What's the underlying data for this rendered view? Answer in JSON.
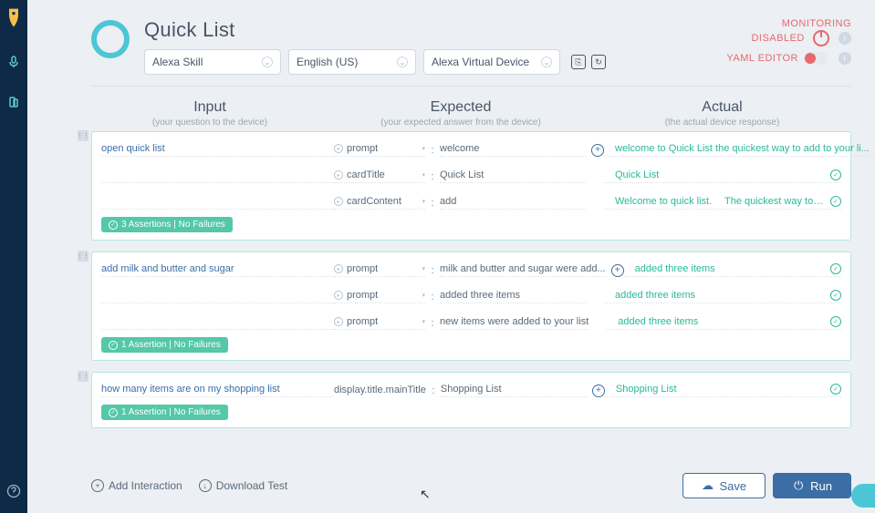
{
  "title": "Quick List",
  "selects": {
    "skill": "Alexa Skill",
    "locale": "English (US)",
    "device": "Alexa Virtual Device"
  },
  "status": {
    "monitoring1": "MONITORING",
    "monitoring2": "DISABLED",
    "yaml": "YAML EDITOR"
  },
  "columns": {
    "input": {
      "title": "Input",
      "sub": "(your question to the device)"
    },
    "expected": {
      "title": "Expected",
      "sub": "(your expected answer from the device)"
    },
    "actual": {
      "title": "Actual",
      "sub": "(the actual device response)"
    }
  },
  "cards": [
    {
      "input": "open quick list",
      "rows": [
        {
          "field": "prompt",
          "expected": "welcome",
          "actual": "welcome to Quick List the quickest way to add to your li...",
          "plus": true
        },
        {
          "field": "cardTitle",
          "expected": "Quick List",
          "actual": "Quick List",
          "plus": false
        },
        {
          "field": "cardContent",
          "expected": "add",
          "actual": "Welcome to quick list.",
          "actual2": "The quickest way to add ...",
          "plus": false
        }
      ],
      "badge": "3 Assertions | No Failures"
    },
    {
      "input": "add milk and butter and sugar",
      "rows": [
        {
          "field": "prompt",
          "expected": "milk and butter and sugar were add...",
          "actual": "added three items",
          "plus": true
        },
        {
          "field": "prompt",
          "expected": "added three items",
          "actual": "added three items",
          "plus": false
        },
        {
          "field": "prompt",
          "expected": "new items were added to your list",
          "actual": "added three items",
          "plus": false
        }
      ],
      "badge": "1 Assertion | No Failures"
    },
    {
      "input": "how many items are on my shopping list",
      "rows": [
        {
          "field": "display.title.mainTitle",
          "fieldPlain": true,
          "expected": "Shopping List",
          "actual": "Shopping List",
          "plus": true
        }
      ],
      "badge": "1 Assertion | No Failures"
    }
  ],
  "footer": {
    "add": "Add Interaction",
    "download": "Download Test",
    "save": "Save",
    "run": "Run"
  }
}
